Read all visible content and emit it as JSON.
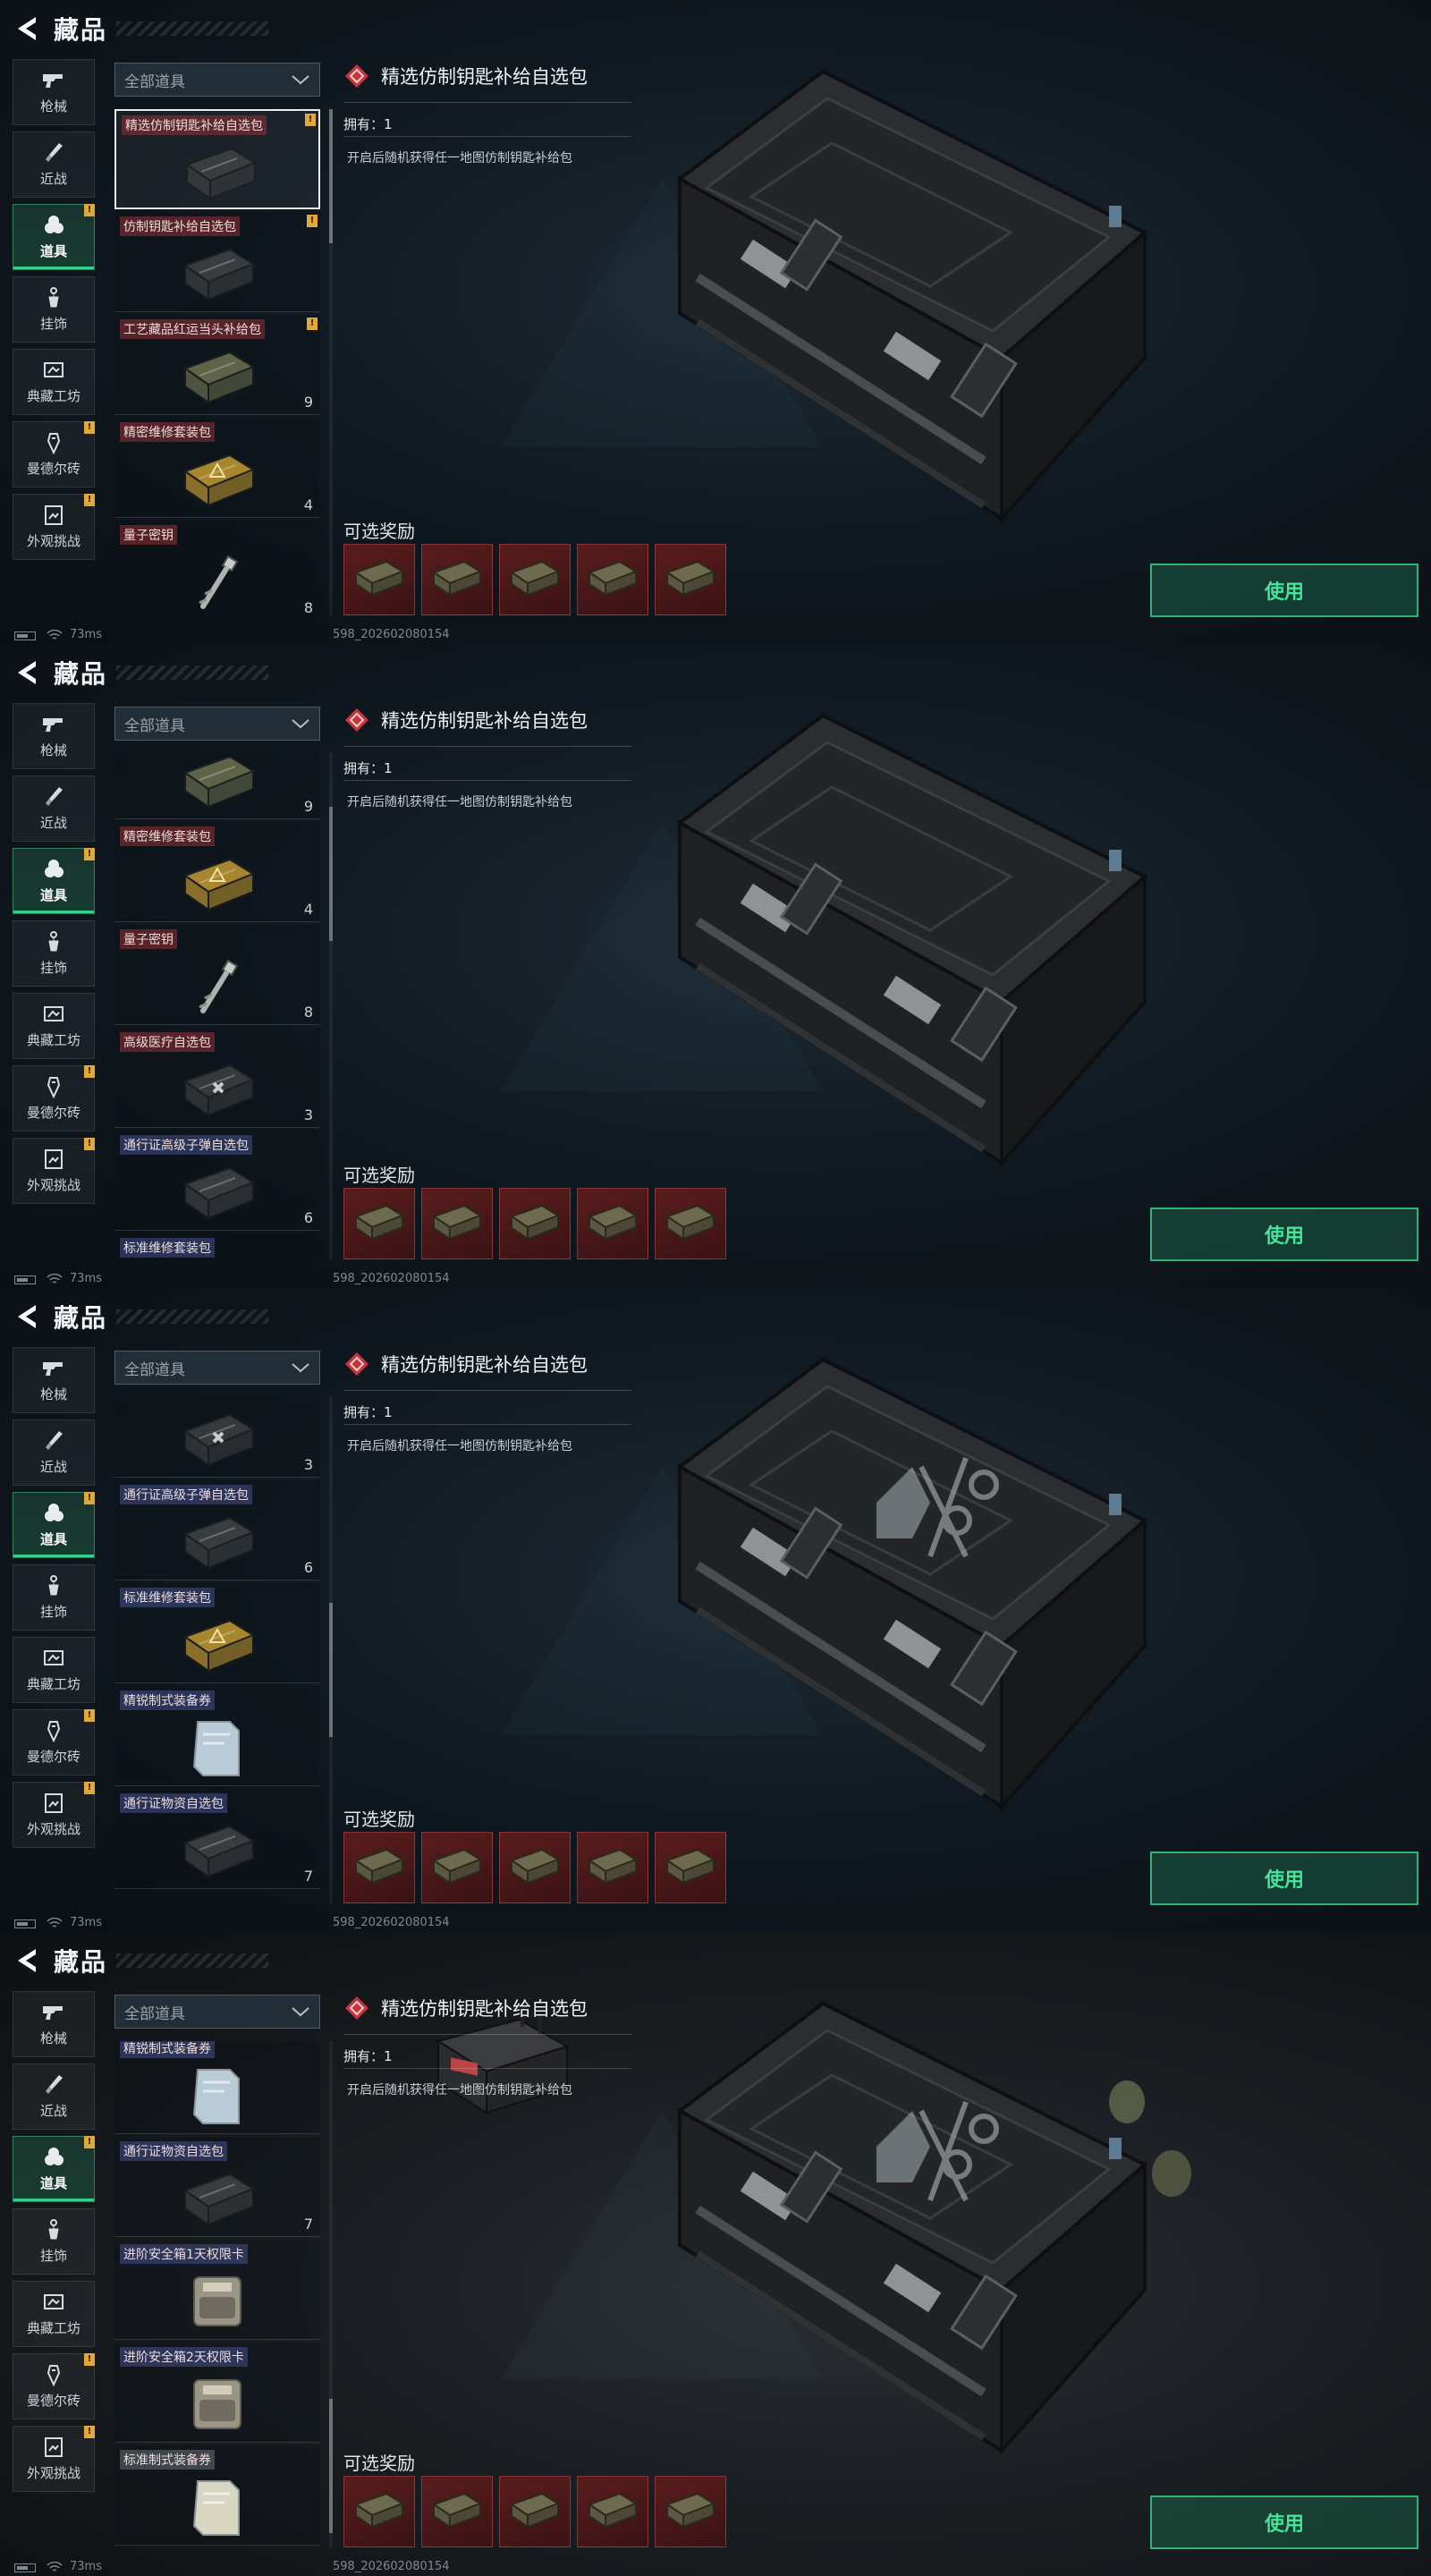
{
  "header": {
    "title": "藏品"
  },
  "nav": [
    {
      "label": "枪械",
      "icon": "gun-icon",
      "flag": false,
      "active": false
    },
    {
      "label": "近战",
      "icon": "knife-icon",
      "flag": false,
      "active": false
    },
    {
      "label": "道具",
      "icon": "grenade-icon",
      "flag": true,
      "active": true
    },
    {
      "label": "挂饰",
      "icon": "charm-icon",
      "flag": false,
      "active": false
    },
    {
      "label": "典藏工坊",
      "icon": "workshop-icon",
      "flag": false,
      "active": false
    },
    {
      "label": "曼德尔砖",
      "icon": "brick-icon",
      "flag": true,
      "active": false
    },
    {
      "label": "外观挑战",
      "icon": "challenge-icon",
      "flag": true,
      "active": false
    }
  ],
  "filter": {
    "label": "全部道具"
  },
  "detail": {
    "title": "精选仿制钥匙补给自选包",
    "owned": "拥有：1",
    "description": "开启后随机获得任一地图仿制钥匙补给包",
    "rewards_label": "可选奖励",
    "use_label": "使用"
  },
  "status": {
    "ping": "73ms",
    "build": "598_202602080154"
  },
  "colors": {
    "accent_green": "#35d08a",
    "flag_yellow": "#e0a93a",
    "reward_red": "#5a1d1e"
  },
  "panels": [
    {
      "list": [
        {
          "name": "精选仿制钥匙补给自选包",
          "tone": "red",
          "count": "",
          "flag": true,
          "selected": true,
          "img": "case-dark"
        },
        {
          "name": "仿制钥匙补给自选包",
          "tone": "red",
          "count": "",
          "flag": true,
          "selected": false,
          "img": "case-dark"
        },
        {
          "name": "工艺藏品红运当头补给包",
          "tone": "red",
          "count": "9",
          "flag": true,
          "selected": false,
          "img": "case-olive"
        },
        {
          "name": "精密维修套装包",
          "tone": "red",
          "count": "4",
          "flag": false,
          "selected": false,
          "img": "case-yellow"
        },
        {
          "name": "量子密钥",
          "tone": "red",
          "count": "8",
          "flag": false,
          "selected": false,
          "img": "key"
        }
      ]
    },
    {
      "list": [
        {
          "name": "",
          "tone": "red",
          "count": "9",
          "flag": false,
          "selected": false,
          "img": "case-olive"
        },
        {
          "name": "精密维修套装包",
          "tone": "red",
          "count": "4",
          "flag": false,
          "selected": false,
          "img": "case-yellow"
        },
        {
          "name": "量子密钥",
          "tone": "red",
          "count": "8",
          "flag": false,
          "selected": false,
          "img": "key"
        },
        {
          "name": "高级医疗自选包",
          "tone": "red",
          "count": "3",
          "flag": false,
          "selected": false,
          "img": "case-med"
        },
        {
          "name": "通行证高级子弹自选包",
          "tone": "blue",
          "count": "6",
          "flag": false,
          "selected": false,
          "img": "case-dark"
        },
        {
          "name": "标准维修套装包",
          "tone": "blue",
          "count": "",
          "flag": false,
          "selected": false,
          "img": "case-yellow"
        }
      ]
    },
    {
      "list": [
        {
          "name": "",
          "tone": "red",
          "count": "3",
          "flag": false,
          "selected": false,
          "img": "case-med"
        },
        {
          "name": "通行证高级子弹自选包",
          "tone": "blue",
          "count": "6",
          "flag": false,
          "selected": false,
          "img": "case-dark"
        },
        {
          "name": "标准维修套装包",
          "tone": "blue",
          "count": "",
          "flag": false,
          "selected": false,
          "img": "case-yellow"
        },
        {
          "name": "精锐制式装备券",
          "tone": "blue",
          "count": "",
          "flag": false,
          "selected": false,
          "img": "ticket"
        },
        {
          "name": "通行证物资自选包",
          "tone": "blue",
          "count": "7",
          "flag": false,
          "selected": false,
          "img": "case-dark"
        }
      ]
    },
    {
      "list": [
        {
          "name": "精锐制式装备券",
          "tone": "blue",
          "count": "",
          "flag": false,
          "selected": false,
          "img": "ticket"
        },
        {
          "name": "通行证物资自选包",
          "tone": "blue",
          "count": "7",
          "flag": false,
          "selected": false,
          "img": "case-dark"
        },
        {
          "name": "进阶安全箱1天权限卡",
          "tone": "blue",
          "count": "",
          "flag": false,
          "selected": false,
          "img": "card"
        },
        {
          "name": "进阶安全箱2天权限卡",
          "tone": "blue",
          "count": "",
          "flag": false,
          "selected": false,
          "img": "card"
        },
        {
          "name": "标准制式装备券",
          "tone": "white",
          "count": "",
          "flag": false,
          "selected": false,
          "img": "ticket-white"
        }
      ]
    }
  ]
}
